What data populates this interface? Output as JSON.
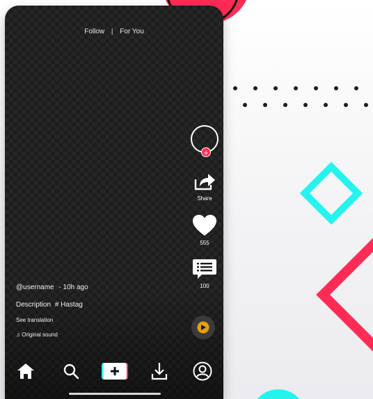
{
  "top_tabs": {
    "follow": "Follow",
    "separator": "|",
    "for_you": "For You"
  },
  "actions": {
    "share_label": "Share",
    "like_count": "555",
    "comment_count": "100"
  },
  "caption": {
    "username": "@username",
    "time": "- 10h ago",
    "description": "Description",
    "hashtag": "# Hastag",
    "see_translation": "See translation",
    "sound_label": "Original sound"
  },
  "bottom_nav": {
    "icons": [
      "home-icon",
      "search-icon",
      "create-icon",
      "download-icon",
      "profile-icon"
    ]
  },
  "colors": {
    "brand_red": "#fe2c55",
    "brand_cyan": "#25f4ee",
    "music_disc": "#e4a112",
    "screen_background": "#1d1d1d"
  }
}
